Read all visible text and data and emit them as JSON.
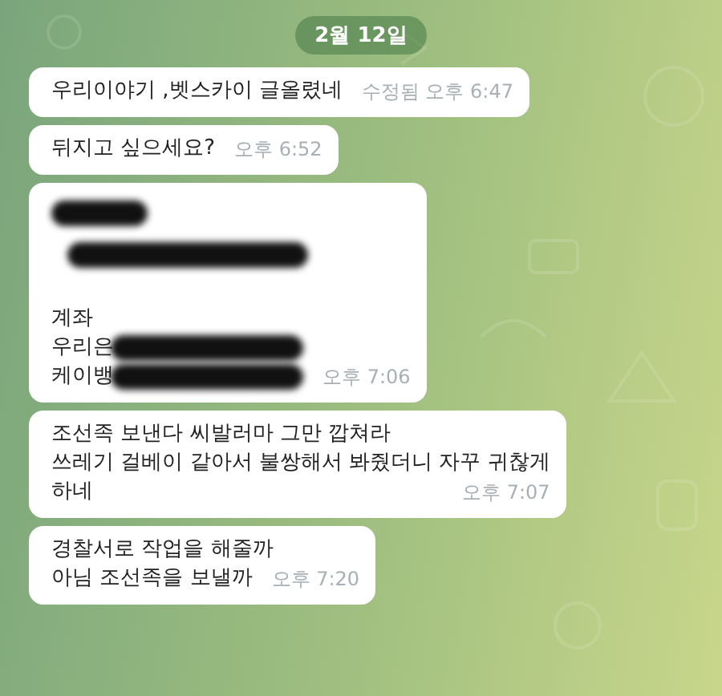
{
  "date_badge": "2월 12일",
  "messages": [
    {
      "lines": [
        {
          "kind": "text",
          "text": "우리이야기 ,벳스카이 글올렸네"
        }
      ],
      "edited_label": "수정됨",
      "time": "오후 6:47"
    },
    {
      "lines": [
        {
          "kind": "text",
          "text": "뒤지고 싶으세요?"
        }
      ],
      "time": "오후 6:52"
    },
    {
      "lines": [
        {
          "kind": "redacted"
        },
        {
          "kind": "redacted"
        },
        {
          "kind": "gap"
        },
        {
          "kind": "text",
          "text": "계좌"
        },
        {
          "kind": "partial",
          "text": "우리은"
        },
        {
          "kind": "partial",
          "text": "케이뱅"
        }
      ],
      "time": "오후 7:06"
    },
    {
      "lines": [
        {
          "kind": "text",
          "text": "조선족 보낸다 씨발러마 그만 깝쳐라"
        },
        {
          "kind": "text",
          "text": "쓰레기 걸베이 같아서 불쌍해서 봐줬더니 자꾸 귀찮게"
        },
        {
          "kind": "text",
          "text": "하네"
        }
      ],
      "time": "오후 7:07"
    },
    {
      "lines": [
        {
          "kind": "text",
          "text": "경찰서로 작업을 해줄까"
        },
        {
          "kind": "text",
          "text": "아님 조선족을 보낼까"
        }
      ],
      "time": "오후 7:20"
    }
  ]
}
